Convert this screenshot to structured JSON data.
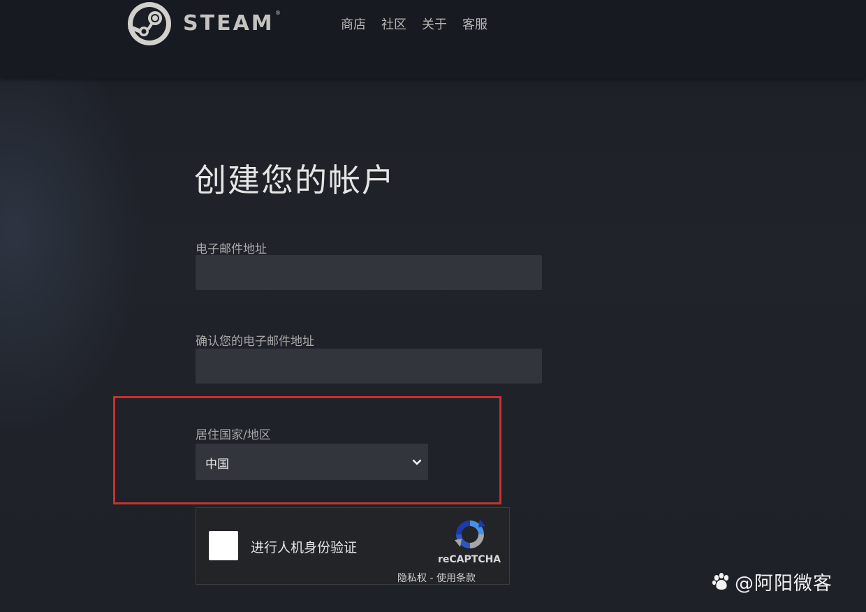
{
  "header": {
    "brand": "STEAM",
    "trademark": "®",
    "nav": [
      "商店",
      "社区",
      "关于",
      "客服"
    ]
  },
  "form": {
    "title": "创建您的帐户",
    "email_label": "电子邮件地址",
    "email_value": "",
    "confirm_email_label": "确认您的电子邮件地址",
    "confirm_email_value": "",
    "country_label": "居住国家/地区",
    "country_value": "中国"
  },
  "captcha": {
    "label": "进行人机身份验证",
    "brand": "reCAPTCHA",
    "privacy": "隐私权",
    "separator": " - ",
    "terms": "使用条款",
    "checked": false
  },
  "watermark": {
    "text": "@阿阳微客",
    "icon": "paw-icon"
  },
  "colors": {
    "highlight": "#c6332e",
    "input_bg": "#32353c",
    "header_bg": "#171a21"
  }
}
